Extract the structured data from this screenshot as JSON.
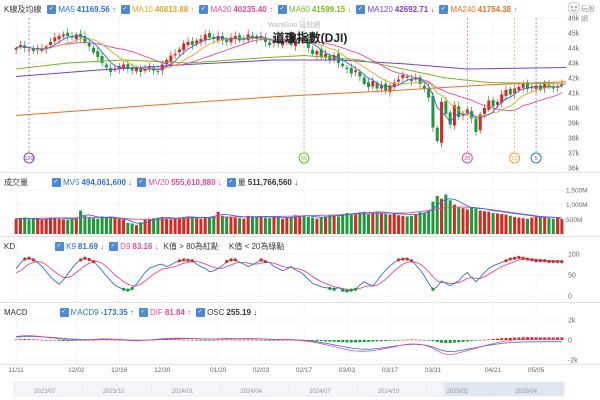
{
  "watermark": "WantGoo 玩股網",
  "logo_text": "玩股網",
  "chart_data": [
    {
      "type": "candlestick",
      "title": "道瓊指數(DJI)",
      "legend_label": "K線及均線",
      "ylim": [
        36,
        46
      ],
      "y_ticks": [
        "46k",
        "45k",
        "44k",
        "43k",
        "42k",
        "41k",
        "40k",
        "39k",
        "38k",
        "37k",
        "36k"
      ],
      "y_tick_values": [
        46000,
        45000,
        44000,
        43000,
        42000,
        41000,
        40000,
        39000,
        38000,
        37000,
        36000
      ],
      "x_tick_labels": [
        "11/11",
        "12/02",
        "12/16",
        "12/30",
        "01/20",
        "02/03",
        "02/17",
        "03/03",
        "03/17",
        "03/31",
        "04/21",
        "05/05"
      ],
      "x_tick_positions": [
        0,
        14,
        24,
        34,
        47,
        57,
        67,
        77,
        87,
        97,
        111,
        121
      ],
      "period_labels": [
        "2023/07",
        "2023/10",
        "2024/01",
        "2024/04",
        "2024/07",
        "2024/10",
        "2025/01",
        "2025/04"
      ],
      "moving_averages": [
        {
          "name": "MA5",
          "value": "41169.56",
          "arrow": "↑",
          "color": "#2f6fd6"
        },
        {
          "name": "MA10",
          "value": "40813.88",
          "arrow": "↑",
          "color": "#e0a82a"
        },
        {
          "name": "MA20",
          "value": "40235.40",
          "arrow": "↑",
          "color": "#e7479a"
        },
        {
          "name": "MA60",
          "value": "41599.15",
          "arrow": "↓",
          "color": "#79b81d"
        },
        {
          "name": "MA120",
          "value": "42692.71",
          "arrow": "↓",
          "color": "#7a3fd4"
        },
        {
          "name": "MA240",
          "value": "41754.38",
          "arrow": "↑",
          "color": "#ef6f1e"
        }
      ],
      "markers": [
        {
          "label": "120",
          "x": 3,
          "color": "#7a3fd4"
        },
        {
          "label": "60",
          "x": 67,
          "color": "#79b81d"
        },
        {
          "label": "20",
          "x": 105,
          "color": "#e7479a"
        },
        {
          "label": "10",
          "x": 116,
          "color": "#e0a82a"
        },
        {
          "label": "5",
          "x": 121,
          "color": "#2f6fd6"
        }
      ],
      "ma_lines": {
        "MA120": [
          [
            0,
            42.1
          ],
          [
            20,
            42.55
          ],
          [
            40,
            42.9
          ],
          [
            60,
            43.2
          ],
          [
            75,
            43.2
          ],
          [
            90,
            42.95
          ],
          [
            105,
            42.6
          ],
          [
            128,
            42.7
          ]
        ],
        "MA240": [
          [
            0,
            39.5
          ],
          [
            30,
            40.15
          ],
          [
            60,
            40.75
          ],
          [
            90,
            41.2
          ],
          [
            110,
            41.55
          ],
          [
            128,
            41.75
          ]
        ],
        "MA60": [
          [
            0,
            42.6
          ],
          [
            12,
            43.0
          ],
          [
            25,
            43.2
          ],
          [
            40,
            43.0
          ],
          [
            55,
            43.3
          ],
          [
            67,
            43.5
          ],
          [
            80,
            43.2
          ],
          [
            90,
            42.6
          ],
          [
            100,
            42.0
          ],
          [
            110,
            41.7
          ],
          [
            128,
            41.6
          ]
        ]
      },
      "closes": [
        44.0,
        44.2,
        44.0,
        43.9,
        43.8,
        43.9,
        44.0,
        44.1,
        44.4,
        44.7,
        44.8,
        44.9,
        44.8,
        44.7,
        44.9,
        44.7,
        44.4,
        44.1,
        43.7,
        43.4,
        43.0,
        42.7,
        42.4,
        42.6,
        42.8,
        42.9,
        42.6,
        42.5,
        42.7,
        42.4,
        42.6,
        42.8,
        42.5,
        42.4,
        42.9,
        43.2,
        43.5,
        43.6,
        43.9,
        44.3,
        44.4,
        44.2,
        44.5,
        44.6,
        44.9,
        44.7,
        44.6,
        44.8,
        44.5,
        44.4,
        44.7,
        44.8,
        44.5,
        44.6,
        44.9,
        44.7,
        44.6,
        44.8,
        44.4,
        44.2,
        44.5,
        44.3,
        44.5,
        44.6,
        44.2,
        44.6,
        44.7,
        44.5,
        44.0,
        43.6,
        43.8,
        43.4,
        43.6,
        43.2,
        43.5,
        43.0,
        42.8,
        42.6,
        42.3,
        42.5,
        42.1,
        41.6,
        41.4,
        41.8,
        41.3,
        41.5,
        41.1,
        41.5,
        41.7,
        41.9,
        42.2,
        42.0,
        41.8,
        42.0,
        41.6,
        41.3,
        40.7,
        38.7,
        37.8,
        40.4,
        39.6,
        38.9,
        40.2,
        39.4,
        39.6,
        39.9,
        39.3,
        38.4,
        39.6,
        40.0,
        40.5,
        40.1,
        40.4,
        40.9,
        41.2,
        40.9,
        41.3,
        41.4,
        41.6,
        41.3,
        41.4,
        41.5,
        41.2,
        41.6,
        41.5,
        41.3,
        41.4,
        41.6
      ]
    },
    {
      "type": "bar",
      "legend_label": "成交量",
      "items": [
        {
          "name": "MV5",
          "value": "494,061,600",
          "arrow": "↓",
          "color": "#2f6fd6"
        },
        {
          "name": "MV20",
          "value": "555,610,880",
          "arrow": "↓",
          "color": "#e7479a"
        },
        {
          "name": "量",
          "value": "511,766,560",
          "arrow": "↓",
          "color": "#333333"
        }
      ],
      "ylim": [
        0,
        1500
      ],
      "y_ticks": [
        "1,500M",
        "1,000M",
        "500M"
      ],
      "y_tick_values": [
        1500,
        1000,
        500
      ],
      "volumes": [
        520,
        540,
        560,
        500,
        520,
        530,
        480,
        510,
        540,
        560,
        520,
        500,
        480,
        510,
        540,
        800,
        620,
        560,
        540,
        520,
        600,
        580,
        560,
        540,
        520,
        500,
        380,
        360,
        300,
        400,
        480,
        520,
        540,
        560,
        580,
        520,
        500,
        540,
        560,
        580,
        600,
        560,
        540,
        520,
        560,
        580,
        600,
        760,
        620,
        600,
        580,
        560,
        540,
        520,
        620,
        600,
        580,
        600,
        560,
        540,
        600,
        580,
        520,
        560,
        580,
        640,
        620,
        600,
        580,
        560,
        520,
        580,
        600,
        640,
        620,
        600,
        680,
        720,
        700,
        660,
        740,
        760,
        680,
        720,
        760,
        720,
        680,
        660,
        700,
        640,
        620,
        600,
        620,
        660,
        740,
        720,
        800,
        1100,
        1300,
        1200,
        1350,
        1150,
        1000,
        920,
        880,
        840,
        900,
        860,
        800,
        780,
        760,
        720,
        700,
        680,
        660,
        620,
        580,
        560,
        540,
        520,
        560,
        580,
        600,
        560,
        540,
        520,
        560,
        510
      ],
      "mv20": [
        520,
        525,
        528,
        530,
        532,
        535,
        538,
        540,
        545,
        548,
        550,
        552,
        550,
        548,
        550,
        560,
        565,
        566,
        565,
        560,
        558,
        556,
        552,
        548,
        540,
        532,
        520,
        510,
        505,
        500,
        498,
        500,
        505,
        510,
        515,
        520,
        525,
        530,
        535,
        540,
        545,
        548,
        552,
        556,
        560,
        564,
        566,
        570,
        575,
        578,
        580,
        582,
        584,
        586,
        588,
        590,
        592,
        594,
        596,
        598,
        600,
        602,
        604,
        606,
        608,
        612,
        616,
        620,
        624,
        628,
        632,
        636,
        640,
        645,
        650,
        655,
        660,
        665,
        670,
        675,
        680,
        685,
        690,
        695,
        700,
        705,
        708,
        710,
        712,
        714,
        716,
        720,
        730,
        745,
        760,
        780,
        800,
        830,
        860,
        880,
        900,
        910,
        915,
        918,
        920,
        915,
        910,
        900,
        880,
        860,
        840,
        820,
        800,
        780,
        760,
        740,
        720,
        700,
        680,
        660,
        640,
        620,
        600,
        590,
        580,
        570,
        560,
        556
      ],
      "mv5": [
        520,
        530,
        540,
        530,
        520,
        510,
        500,
        505,
        520,
        540,
        550,
        540,
        520,
        510,
        520,
        600,
        640,
        650,
        620,
        580,
        560,
        570,
        580,
        570,
        550,
        530,
        480,
        430,
        380,
        360,
        380,
        430,
        480,
        520,
        550,
        560,
        560,
        540,
        540,
        560,
        580,
        580,
        570,
        560,
        560,
        570,
        600,
        640,
        660,
        660,
        640,
        620,
        600,
        580,
        580,
        580,
        580,
        590,
        590,
        580,
        580,
        580,
        570,
        560,
        560,
        580,
        600,
        620,
        620,
        600,
        580,
        570,
        580,
        600,
        620,
        630,
        640,
        660,
        680,
        700,
        710,
        720,
        730,
        740,
        750,
        750,
        740,
        720,
        700,
        690,
        680,
        670,
        660,
        660,
        680,
        720,
        760,
        860,
        980,
        1100,
        1180,
        1200,
        1180,
        1120,
        1040,
        960,
        900,
        880,
        870,
        860,
        820,
        800,
        780,
        760,
        740,
        720,
        700,
        680,
        660,
        640,
        620,
        600,
        580,
        570,
        570,
        570,
        560,
        494
      ]
    },
    {
      "type": "line",
      "legend_label": "KD",
      "items": [
        {
          "name": "K9",
          "value": "81.69",
          "arrow": "↓",
          "color": "#2f6fd6"
        },
        {
          "name": "D9",
          "value": "83.16",
          "arrow": "↓",
          "color": "#e7479a"
        }
      ],
      "notes": [
        "K值 > 80為紅點",
        "K值 < 20為綠點"
      ],
      "ylim": [
        0,
        100
      ],
      "y_ticks": [
        "100",
        "50",
        "0"
      ],
      "y_tick_values": [
        100,
        50,
        0
      ],
      "k_values": [
        65,
        78,
        88,
        90,
        86,
        80,
        70,
        58,
        46,
        36,
        28,
        38,
        52,
        66,
        78,
        86,
        90,
        87,
        82,
        72,
        60,
        48,
        36,
        26,
        20,
        16,
        14,
        18,
        28,
        42,
        56,
        66,
        70,
        74,
        76,
        70,
        74,
        80,
        84,
        86,
        85,
        84,
        76,
        70,
        66,
        58,
        60,
        66,
        72,
        82,
        86,
        86,
        80,
        76,
        70,
        74,
        80,
        86,
        82,
        80,
        70,
        66,
        60,
        64,
        70,
        62,
        58,
        50,
        40,
        30,
        26,
        22,
        20,
        18,
        16,
        20,
        14,
        12,
        14,
        16,
        26,
        34,
        28,
        24,
        36,
        50,
        62,
        72,
        80,
        86,
        88,
        88,
        84,
        74,
        62,
        48,
        30,
        16,
        22,
        36,
        30,
        24,
        30,
        36,
        48,
        56,
        44,
        34,
        44,
        56,
        66,
        72,
        76,
        80,
        84,
        88,
        90,
        92,
        90,
        88,
        86,
        84,
        84,
        84,
        82,
        82,
        82,
        81.69
      ],
      "d_values": [
        55,
        60,
        68,
        76,
        80,
        82,
        80,
        74,
        66,
        58,
        50,
        44,
        44,
        48,
        56,
        64,
        72,
        78,
        82,
        82,
        78,
        70,
        60,
        50,
        42,
        34,
        28,
        24,
        24,
        28,
        36,
        44,
        52,
        58,
        64,
        66,
        68,
        70,
        74,
        78,
        80,
        82,
        82,
        80,
        76,
        72,
        68,
        66,
        66,
        70,
        74,
        78,
        80,
        80,
        78,
        76,
        76,
        78,
        80,
        80,
        78,
        74,
        70,
        68,
        68,
        66,
        64,
        60,
        54,
        46,
        40,
        34,
        30,
        26,
        22,
        20,
        18,
        16,
        16,
        16,
        18,
        22,
        24,
        24,
        26,
        32,
        40,
        50,
        60,
        68,
        76,
        80,
        82,
        80,
        76,
        68,
        58,
        46,
        36,
        32,
        32,
        30,
        30,
        32,
        36,
        42,
        44,
        42,
        42,
        46,
        52,
        58,
        64,
        70,
        74,
        78,
        82,
        86,
        88,
        88,
        88,
        87,
        86,
        85,
        84,
        84,
        83,
        83.16
      ]
    },
    {
      "type": "bar",
      "legend_label": "MACD",
      "items": [
        {
          "name": "MACD9",
          "value": "-173.35",
          "arrow": "↑",
          "color": "#2f6fd6"
        },
        {
          "name": "DIF",
          "value": "81.84",
          "arrow": "↑",
          "color": "#e7479a"
        },
        {
          "name": "OSC",
          "value": "255.19",
          "arrow": "↓",
          "color": "#333333"
        }
      ],
      "ylim": [
        -2,
        2
      ],
      "y_ticks": [
        "2k",
        "0",
        "-2k"
      ],
      "y_tick_values": [
        2,
        0,
        -2
      ],
      "osc": [
        0.05,
        0.08,
        0.1,
        0.08,
        0.06,
        0.05,
        0.02,
        -0.02,
        -0.05,
        -0.06,
        -0.08,
        -0.1,
        -0.12,
        -0.1,
        -0.08,
        -0.06,
        -0.04,
        -0.02,
        0.01,
        0.03,
        0.05,
        0.04,
        0.03,
        0.02,
        0.01,
        -0.02,
        -0.04,
        -0.06,
        -0.05,
        -0.03,
        -0.02,
        0.01,
        0.03,
        0.05,
        0.07,
        0.08,
        0.07,
        0.06,
        0.05,
        0.03,
        0.02,
        0.01,
        -0.01,
        -0.02,
        -0.03,
        -0.02,
        -0.01,
        0.02,
        0.03,
        0.04,
        0.03,
        0.02,
        0.01,
        0.02,
        0.03,
        0.02,
        0.01,
        -0.01,
        -0.02,
        -0.03,
        -0.02,
        -0.01,
        0.01,
        0.02,
        0.01,
        -0.01,
        -0.03,
        -0.05,
        -0.07,
        -0.08,
        -0.1,
        -0.12,
        -0.14,
        -0.16,
        -0.18,
        -0.2,
        -0.22,
        -0.24,
        -0.25,
        -0.24,
        -0.22,
        -0.2,
        -0.18,
        -0.16,
        -0.14,
        -0.12,
        -0.1,
        -0.08,
        -0.05,
        -0.02,
        0.01,
        0.03,
        0.05,
        0.04,
        0.02,
        -0.02,
        -0.06,
        -0.12,
        -0.2,
        -0.28,
        -0.32,
        -0.3,
        -0.26,
        -0.22,
        -0.18,
        -0.14,
        -0.1,
        -0.06,
        -0.02,
        0.02,
        0.06,
        0.1,
        0.14,
        0.18,
        0.2,
        0.22,
        0.24,
        0.26,
        0.27,
        0.28,
        0.28,
        0.27,
        0.26,
        0.26,
        0.26,
        0.26,
        0.26,
        0.255
      ],
      "macd_line": [
        0.3,
        0.32,
        0.34,
        0.35,
        0.35,
        0.34,
        0.32,
        0.3,
        0.27,
        0.24,
        0.2,
        0.16,
        0.12,
        0.1,
        0.08,
        0.06,
        0.05,
        0.04,
        0.04,
        0.05,
        0.06,
        0.07,
        0.07,
        0.06,
        0.05,
        0.03,
        0.01,
        -0.01,
        -0.02,
        -0.02,
        -0.01,
        0.0,
        0.02,
        0.04,
        0.06,
        0.08,
        0.1,
        0.12,
        0.13,
        0.14,
        0.14,
        0.14,
        0.13,
        0.12,
        0.11,
        0.1,
        0.1,
        0.1,
        0.11,
        0.12,
        0.12,
        0.12,
        0.12,
        0.12,
        0.12,
        0.12,
        0.12,
        0.11,
        0.1,
        0.08,
        0.06,
        0.05,
        0.04,
        0.04,
        0.03,
        0.02,
        0.0,
        -0.03,
        -0.07,
        -0.12,
        -0.18,
        -0.25,
        -0.32,
        -0.4,
        -0.48,
        -0.56,
        -0.64,
        -0.72,
        -0.8,
        -0.86,
        -0.9,
        -0.92,
        -0.92,
        -0.9,
        -0.86,
        -0.8,
        -0.74,
        -0.68,
        -0.62,
        -0.56,
        -0.5,
        -0.46,
        -0.44,
        -0.44,
        -0.46,
        -0.5,
        -0.58,
        -0.7,
        -0.86,
        -1.02,
        -1.12,
        -1.16,
        -1.14,
        -1.08,
        -1.0,
        -0.92,
        -0.84,
        -0.76,
        -0.68,
        -0.6,
        -0.52,
        -0.46,
        -0.4,
        -0.34,
        -0.3,
        -0.26,
        -0.24,
        -0.22,
        -0.2,
        -0.19,
        -0.18,
        -0.18,
        -0.18,
        -0.17,
        -0.17,
        -0.17,
        -0.17,
        -0.17
      ]
    }
  ]
}
